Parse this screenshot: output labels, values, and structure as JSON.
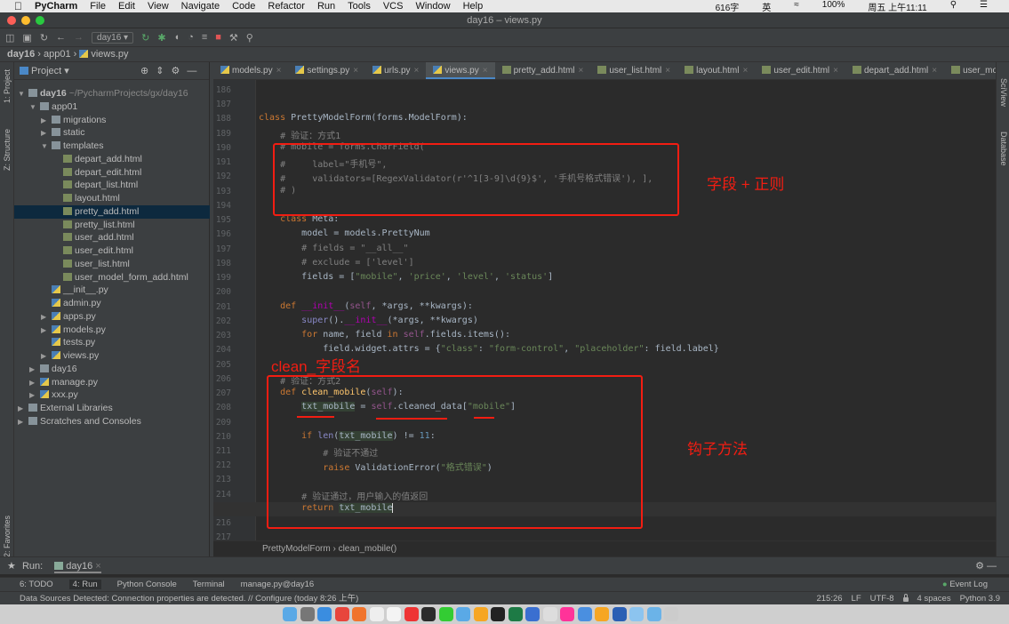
{
  "menubar": {
    "app": "PyCharm",
    "items": [
      "File",
      "Edit",
      "View",
      "Navigate",
      "Code",
      "Refactor",
      "Run",
      "Tools",
      "VCS",
      "Window",
      "Help"
    ],
    "status": {
      "wordcount": "616字",
      "lang": "英",
      "battery": "100%",
      "datetime": "周五 上午11:11"
    }
  },
  "window": {
    "title": "day16 – views.py"
  },
  "toolbar": {
    "run_config": "day16"
  },
  "breadcrumb": [
    "day16",
    "app01",
    "views.py"
  ],
  "sidebar": {
    "title": "Project",
    "strip_labels": [
      "1: Project",
      "Z: Structure",
      "2: Favorites"
    ],
    "items": [
      {
        "label": "day16",
        "extra": " ~/PycharmProjects/gx/day16",
        "depth": 0,
        "type": "folder",
        "open": true
      },
      {
        "label": "app01",
        "depth": 1,
        "type": "folder",
        "open": true
      },
      {
        "label": "migrations",
        "depth": 2,
        "type": "folder"
      },
      {
        "label": "static",
        "depth": 2,
        "type": "folder"
      },
      {
        "label": "templates",
        "depth": 2,
        "type": "folder",
        "open": true
      },
      {
        "label": "depart_add.html",
        "depth": 3,
        "type": "html"
      },
      {
        "label": "depart_edit.html",
        "depth": 3,
        "type": "html"
      },
      {
        "label": "depart_list.html",
        "depth": 3,
        "type": "html"
      },
      {
        "label": "layout.html",
        "depth": 3,
        "type": "html"
      },
      {
        "label": "pretty_add.html",
        "depth": 3,
        "type": "html",
        "selected": true
      },
      {
        "label": "pretty_list.html",
        "depth": 3,
        "type": "html"
      },
      {
        "label": "user_add.html",
        "depth": 3,
        "type": "html"
      },
      {
        "label": "user_edit.html",
        "depth": 3,
        "type": "html"
      },
      {
        "label": "user_list.html",
        "depth": 3,
        "type": "html"
      },
      {
        "label": "user_model_form_add.html",
        "depth": 3,
        "type": "html"
      },
      {
        "label": "__init__.py",
        "depth": 2,
        "type": "py",
        "leaf": true
      },
      {
        "label": "admin.py",
        "depth": 2,
        "type": "py",
        "leaf": true
      },
      {
        "label": "apps.py",
        "depth": 2,
        "type": "py"
      },
      {
        "label": "models.py",
        "depth": 2,
        "type": "py"
      },
      {
        "label": "tests.py",
        "depth": 2,
        "type": "py",
        "leaf": true
      },
      {
        "label": "views.py",
        "depth": 2,
        "type": "py"
      },
      {
        "label": "day16",
        "depth": 1,
        "type": "folder"
      },
      {
        "label": "manage.py",
        "depth": 1,
        "type": "py"
      },
      {
        "label": "xxx.py",
        "depth": 1,
        "type": "py"
      },
      {
        "label": "External Libraries",
        "depth": 0,
        "type": "folder"
      },
      {
        "label": "Scratches and Consoles",
        "depth": 0,
        "type": "folder"
      }
    ]
  },
  "tabs": [
    {
      "label": "models.py"
    },
    {
      "label": "settings.py"
    },
    {
      "label": "urls.py"
    },
    {
      "label": "views.py",
      "active": true
    },
    {
      "label": "pretty_add.html"
    },
    {
      "label": "user_list.html"
    },
    {
      "label": "layout.html"
    },
    {
      "label": "user_edit.html"
    },
    {
      "label": "depart_add.html"
    },
    {
      "label": "user_model_form_ac"
    }
  ],
  "right_strip": [
    "SciView",
    "Database"
  ],
  "code": [
    {
      "n": "186",
      "t": []
    },
    {
      "n": "187",
      "t": []
    },
    {
      "n": "188",
      "t": [
        [
          "class ",
          "kw"
        ],
        [
          "PrettyModelForm(forms.ModelForm):",
          ""
        ]
      ]
    },
    {
      "n": "189",
      "t": [
        [
          "    # 验证：方式1",
          "cm"
        ]
      ]
    },
    {
      "n": "190",
      "t": [
        [
          "    # mobile = forms.CharField(",
          "cm"
        ]
      ]
    },
    {
      "n": "191",
      "t": [
        [
          "    #     label=\"手机号\",",
          "cm"
        ]
      ]
    },
    {
      "n": "192",
      "t": [
        [
          "    #     validators=[RegexValidator(r'^1[3-9]\\d{9}$', '手机号格式错误'), ],",
          "cm"
        ]
      ]
    },
    {
      "n": "193",
      "t": [
        [
          "    # )",
          "cm"
        ]
      ]
    },
    {
      "n": "194",
      "t": []
    },
    {
      "n": "195",
      "t": [
        [
          "    class ",
          "kw"
        ],
        [
          "Meta:",
          ""
        ]
      ]
    },
    {
      "n": "196",
      "t": [
        [
          "        model = models.PrettyNum",
          ""
        ]
      ]
    },
    {
      "n": "197",
      "t": [
        [
          "        # fields = \"__all__\"",
          "cm"
        ]
      ]
    },
    {
      "n": "198",
      "t": [
        [
          "        # exclude = ['level']",
          "cm"
        ]
      ]
    },
    {
      "n": "199",
      "t": [
        [
          "        fields = [",
          ""
        ],
        [
          "\"mobile\"",
          "st"
        ],
        [
          ", ",
          ""
        ],
        [
          "'price'",
          "st"
        ],
        [
          ", ",
          ""
        ],
        [
          "'level'",
          "st"
        ],
        [
          ", ",
          ""
        ],
        [
          "'status'",
          "st"
        ],
        [
          "]",
          ""
        ]
      ]
    },
    {
      "n": "200",
      "t": []
    },
    {
      "n": "201",
      "t": [
        [
          "    def ",
          "kw"
        ],
        [
          "__init__",
          "ma"
        ],
        [
          "(",
          ""
        ],
        [
          "self",
          "sf"
        ],
        [
          ", *args, **kwargs):",
          ""
        ]
      ]
    },
    {
      "n": "202",
      "t": [
        [
          "        ",
          ""
        ],
        [
          "super",
          "bi"
        ],
        [
          "().",
          ""
        ],
        [
          "__init__",
          "ma"
        ],
        [
          "(*args, **kwargs)",
          ""
        ]
      ]
    },
    {
      "n": "203",
      "t": [
        [
          "        for ",
          "kw"
        ],
        [
          "name, field ",
          ""
        ],
        [
          "in ",
          "kw"
        ],
        [
          "self",
          "sf"
        ],
        [
          ".fields.items():",
          ""
        ]
      ]
    },
    {
      "n": "204",
      "t": [
        [
          "            field.widget.attrs = {",
          ""
        ],
        [
          "\"class\"",
          "st"
        ],
        [
          ": ",
          ""
        ],
        [
          "\"form-control\"",
          "st"
        ],
        [
          ", ",
          ""
        ],
        [
          "\"placeholder\"",
          "st"
        ],
        [
          ": field.label}",
          ""
        ]
      ]
    },
    {
      "n": "205",
      "t": []
    },
    {
      "n": "206",
      "t": [
        [
          "    # 验证：方式2",
          "cm"
        ]
      ]
    },
    {
      "n": "207",
      "t": [
        [
          "    def ",
          "kw"
        ],
        [
          "clean_mobile",
          "fn"
        ],
        [
          "(",
          ""
        ],
        [
          "self",
          "sf"
        ],
        [
          "):",
          ""
        ]
      ]
    },
    {
      "n": "208",
      "t": [
        [
          "        ",
          ""
        ],
        [
          "txt_mobile",
          "hl"
        ],
        [
          " = ",
          ""
        ],
        [
          "self",
          "sf"
        ],
        [
          ".cleaned_data[",
          ""
        ],
        [
          "\"mobile\"",
          "st"
        ],
        [
          "]",
          ""
        ]
      ]
    },
    {
      "n": "209",
      "t": []
    },
    {
      "n": "210",
      "t": [
        [
          "        if ",
          "kw"
        ],
        [
          "len",
          "bi"
        ],
        [
          "(",
          ""
        ],
        [
          "txt_mobile",
          "hl"
        ],
        [
          ") != ",
          ""
        ],
        [
          "11",
          "nm"
        ],
        [
          ":",
          ""
        ]
      ]
    },
    {
      "n": "211",
      "t": [
        [
          "            # 验证不通过",
          "cm"
        ]
      ]
    },
    {
      "n": "212",
      "t": [
        [
          "            raise ",
          "kw"
        ],
        [
          "ValidationError(",
          ""
        ],
        [
          "\"格式错误\"",
          "st"
        ],
        [
          ")",
          ""
        ]
      ]
    },
    {
      "n": "213",
      "t": []
    },
    {
      "n": "214",
      "t": [
        [
          "        # 验证通过，用户输入的值返回",
          "cm"
        ]
      ]
    },
    {
      "n": "215",
      "t": [
        [
          "        return ",
          "kw"
        ],
        [
          "txt_mobile",
          "hl"
        ]
      ],
      "current": true
    },
    {
      "n": "216",
      "t": []
    },
    {
      "n": "217",
      "t": []
    }
  ],
  "editor_breadcrumb": [
    "PrettyModelForm",
    "clean_mobile()"
  ],
  "annotations": {
    "box1_label": "字段 + 正则",
    "box2_title": "clean_字段名",
    "box2_label": "钩子方法",
    "color": "#f21d12"
  },
  "run": {
    "label": "Run:",
    "config": "day16"
  },
  "toolwindows": [
    "6: TODO",
    "4: Run",
    "Python Console",
    "Terminal",
    "manage.py@day16"
  ],
  "event_log": "Event Log",
  "status": {
    "message": "Data Sources Detected: Connection properties are detected. // Configure (today 8:26 上午)",
    "position": "215:26",
    "line_sep": "LF",
    "encoding": "UTF-8",
    "indent": "4 spaces",
    "interpreter": "Python 3.9"
  }
}
